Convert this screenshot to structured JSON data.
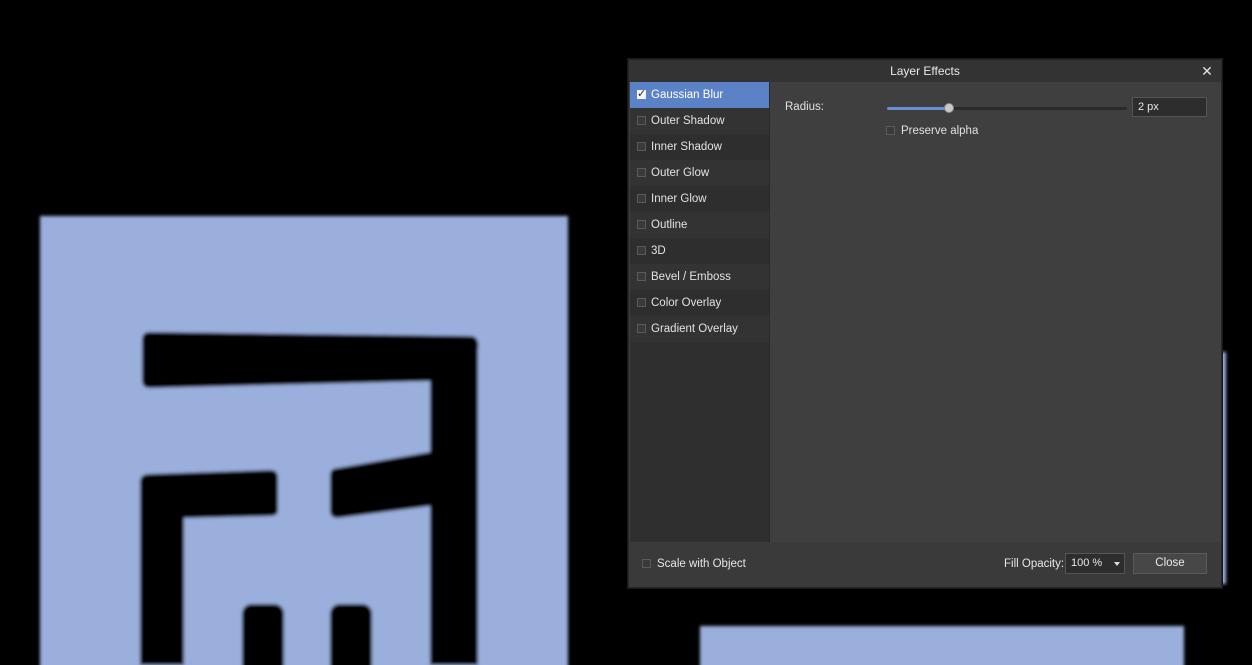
{
  "canvas": {
    "fill_color": "#9aafdc",
    "background_color": "#000000"
  },
  "dialog": {
    "title": "Layer Effects",
    "close_glyph": "✕",
    "close_icon": "close-icon",
    "effects": [
      {
        "label": "Gaussian Blur",
        "checked": true,
        "selected": true
      },
      {
        "label": "Outer Shadow",
        "checked": false,
        "selected": false
      },
      {
        "label": "Inner Shadow",
        "checked": false,
        "selected": false
      },
      {
        "label": "Outer Glow",
        "checked": false,
        "selected": false
      },
      {
        "label": "Inner Glow",
        "checked": false,
        "selected": false
      },
      {
        "label": "Outline",
        "checked": false,
        "selected": false
      },
      {
        "label": "3D",
        "checked": false,
        "selected": false
      },
      {
        "label": "Bevel / Emboss",
        "checked": false,
        "selected": false
      },
      {
        "label": "Color Overlay",
        "checked": false,
        "selected": false
      },
      {
        "label": "Gradient Overlay",
        "checked": false,
        "selected": false
      }
    ],
    "settings": {
      "radius_label": "Radius:",
      "radius_value": "2 px",
      "radius_slider_fraction": 0.26,
      "preserve_alpha_label": "Preserve alpha",
      "preserve_alpha_checked": false
    },
    "footer": {
      "scale_with_object_label": "Scale with Object",
      "scale_with_object_checked": false,
      "fill_opacity_label": "Fill Opacity:",
      "fill_opacity_value": "100 %",
      "close_button_label": "Close"
    },
    "accent_color": "#5b82c6"
  }
}
